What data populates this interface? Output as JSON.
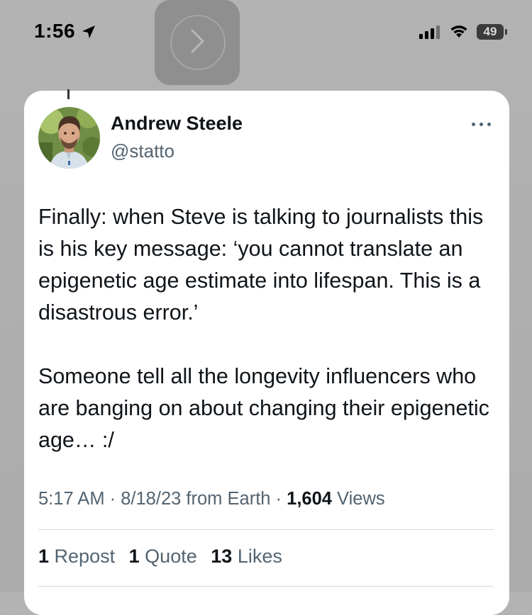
{
  "status_bar": {
    "time": "1:56",
    "battery": "49",
    "icons": [
      "location-arrow-icon",
      "cellular-signal-icon",
      "wifi-icon",
      "battery-icon"
    ]
  },
  "overlay": {
    "forward_icon": "chevron-right-icon"
  },
  "tweet": {
    "author": {
      "name": "Andrew Steele",
      "handle": "@statto"
    },
    "more_icon": "more-horizontal-icon",
    "paragraphs": [
      "Finally: when Steve is talking to journalists this is his key message: ‘you cannot translate an epigenetic age estimate into lifespan. This is a disastrous error.’",
      "Someone tell all the longevity influencers who are banging on about changing their epigenetic age… :/"
    ],
    "meta": {
      "time": "5:17 AM",
      "separator": " · ",
      "date": "8/18/23",
      "source": "from Earth",
      "views_count": "1,604",
      "views_label": "Views"
    },
    "stats": {
      "reposts_count": "1",
      "reposts_label": "Repost",
      "quotes_count": "1",
      "quotes_label": "Quote",
      "likes_count": "13",
      "likes_label": "Likes"
    }
  },
  "colors": {
    "background": "#b0b0b0",
    "card": "#ffffff",
    "text_primary": "#0f1419",
    "text_secondary": "#536471",
    "divider": "#cfd9de"
  }
}
